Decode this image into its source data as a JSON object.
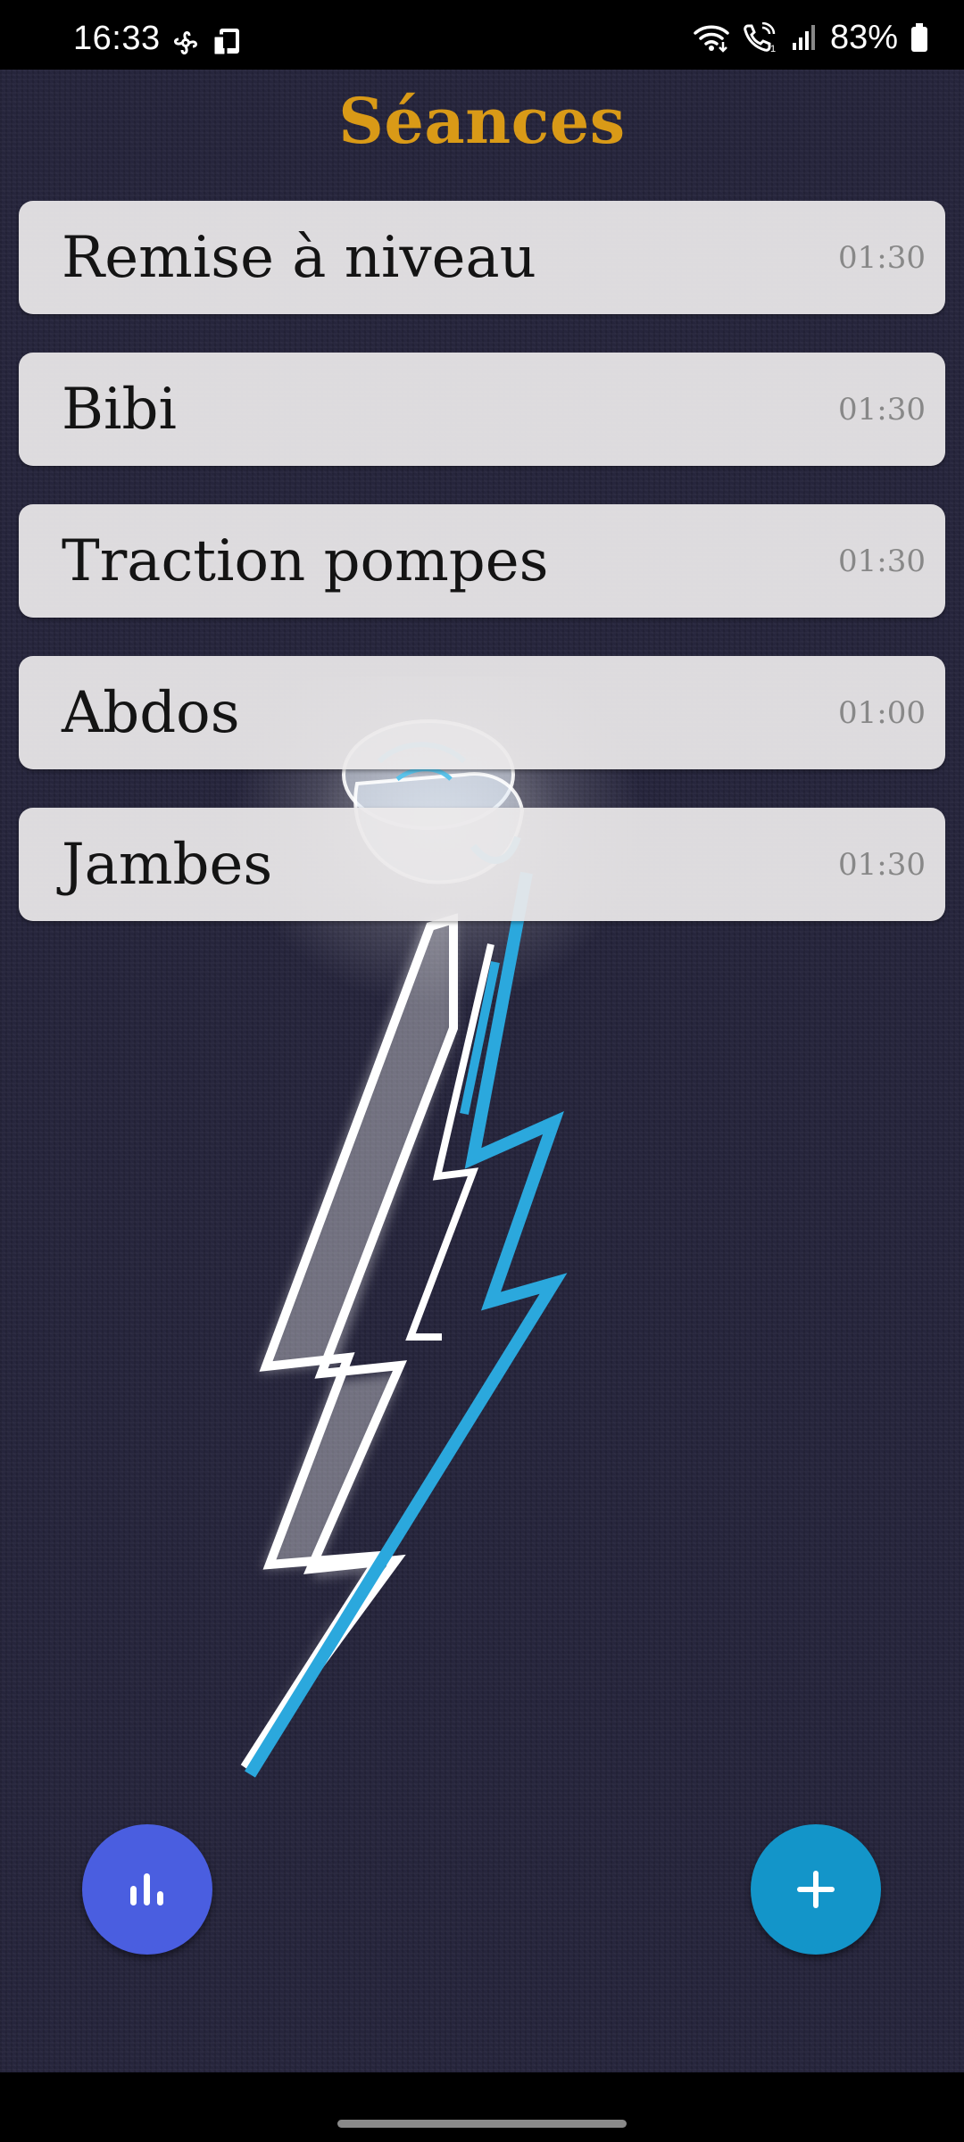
{
  "status_bar": {
    "time": "16:33",
    "battery": "83%",
    "icons": [
      "pinwheel-icon",
      "tablet-icon",
      "wifi-icon",
      "wifi-calling-icon",
      "signal-icon",
      "battery-icon"
    ]
  },
  "app": {
    "title": "Séances",
    "title_color": "#d99a17",
    "background_color": "#26253c",
    "sessions": [
      {
        "name": "Remise à niveau",
        "duration": "01:30"
      },
      {
        "name": "Bibi",
        "duration": "01:30"
      },
      {
        "name": "Traction pompes",
        "duration": "01:30"
      },
      {
        "name": "Abdos",
        "duration": "01:00"
      },
      {
        "name": "Jambes",
        "duration": "01:30"
      }
    ],
    "fab_stats": {
      "icon": "bar-chart-icon",
      "color": "#4a5ee0"
    },
    "fab_add": {
      "icon": "plus-icon",
      "color": "#1395c9"
    }
  }
}
